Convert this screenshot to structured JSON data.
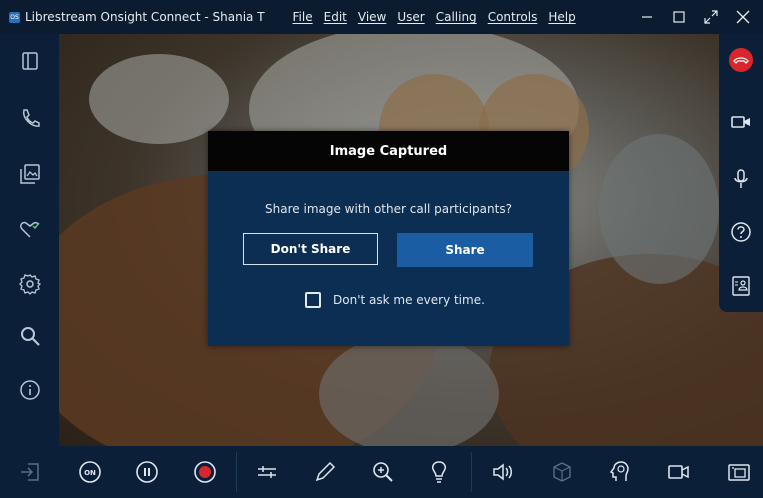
{
  "window": {
    "title": "Librestream Onsight Connect - Shania T",
    "app_icon_text": "OS",
    "menu": [
      {
        "label": "File"
      },
      {
        "label": "Edit"
      },
      {
        "label": "View"
      },
      {
        "label": "User"
      },
      {
        "label": "Calling"
      },
      {
        "label": "Controls"
      },
      {
        "label": "Help"
      }
    ],
    "controls": [
      "minimize-icon",
      "maximize-icon",
      "fullscreen-icon",
      "close-icon"
    ]
  },
  "sidebar": {
    "items": [
      {
        "icon": "panel-toggle-icon"
      },
      {
        "icon": "phone-icon"
      },
      {
        "icon": "gallery-icon"
      },
      {
        "icon": "heart-check-icon"
      },
      {
        "icon": "gear-icon"
      },
      {
        "icon": "search-icon"
      },
      {
        "icon": "info-icon"
      }
    ],
    "exit_icon": "exit-icon"
  },
  "call_panel": {
    "items": [
      {
        "icon": "end-call-icon"
      },
      {
        "icon": "video-camera-icon"
      },
      {
        "icon": "microphone-icon"
      },
      {
        "icon": "help-icon"
      },
      {
        "icon": "contact-card-icon"
      }
    ]
  },
  "toolbar": {
    "on_label": "ON",
    "items": [
      "power-on-icon",
      "pause-icon",
      "record-icon",
      "adjust-icon",
      "pen-icon",
      "zoom-in-icon",
      "light-icon",
      "speaker-icon",
      "3d-icon",
      "ar-head-icon",
      "video-camera-icon",
      "snapshot-icon"
    ]
  },
  "dialog": {
    "title": "Image Captured",
    "message": "Share image with other call participants?",
    "dont_share_label": "Don't Share",
    "share_label": "Share",
    "checkbox_label": "Don't ask me every time.",
    "checkbox_checked": false
  },
  "colors": {
    "end_call": "#d9262c",
    "share_button": "#1a5da3",
    "dialog_bg": "#0c2e52",
    "sidebar_bg": "#0b2038"
  }
}
